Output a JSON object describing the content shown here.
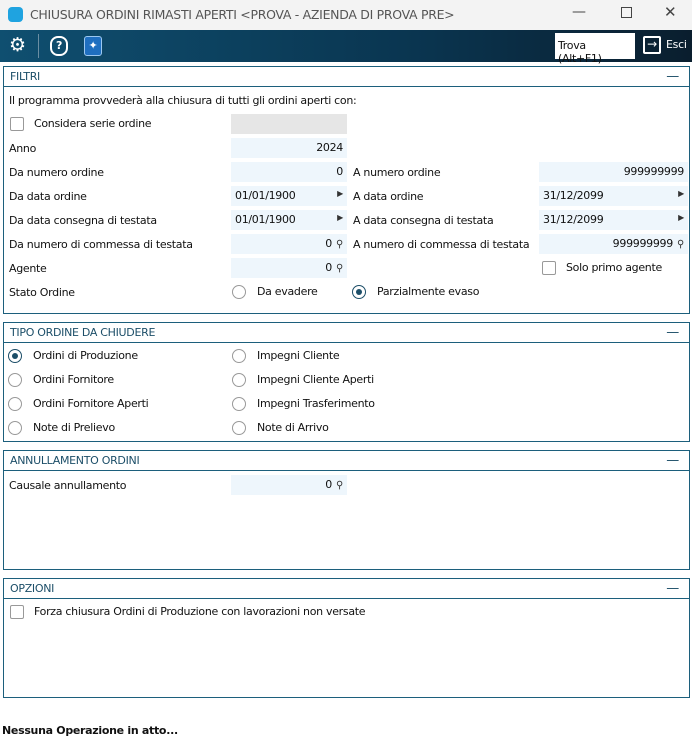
{
  "window": {
    "title": "CHIUSURA ORDINI RIMASTI APERTI <PROVA - AZIENDA DI PROVA PRE>"
  },
  "toolbar": {
    "find_label": "Trova (Alt+F1)",
    "exit_label": "Esci"
  },
  "filtri": {
    "title": "FILTRI",
    "intro": "Il programma provvederà alla chiusura di tutti gli ordini aperti con:",
    "considera_serie": "Considera serie ordine",
    "anno_label": "Anno",
    "anno": "2024",
    "da_num_label": "Da numero ordine",
    "da_num": "0",
    "a_num_label": "A numero ordine",
    "a_num": "999999999",
    "da_data_label": "Da data ordine",
    "da_data": "01/01/1900",
    "a_data_label": "A data ordine",
    "a_data": "31/12/2099",
    "da_cons_label": "Da data consegna di testata",
    "da_cons": "01/01/1900",
    "a_cons_label": "A data consegna di testata",
    "a_cons": "31/12/2099",
    "da_comm_label": "Da numero di commessa di testata",
    "da_comm": "0",
    "a_comm_label": "A numero di commessa di testata",
    "a_comm": "999999999",
    "agente_label": "Agente",
    "agente": "0",
    "solo_primo": "Solo primo agente",
    "stato_label": "Stato Ordine",
    "stato_opt1": "Da evadere",
    "stato_opt2": "Parzialmente evaso"
  },
  "tipo": {
    "title": "TIPO ORDINE DA CHIUDERE",
    "options": [
      "Ordini di Produzione",
      "Ordini Fornitore",
      "Ordini Fornitore Aperti",
      "Note di Prelievo",
      "Impegni Cliente",
      "Impegni Cliente Aperti",
      "Impegni Trasferimento",
      "Note di Arrivo"
    ],
    "selected": "Ordini di Produzione"
  },
  "annullamento": {
    "title": "ANNULLAMENTO ORDINI",
    "causale_label": "Causale annullamento",
    "causale": "0"
  },
  "opzioni": {
    "title": "OPZIONI",
    "forza": "Forza chiusura Ordini di Produzione con lavorazioni non versate"
  },
  "status": "Nessuna Operazione in atto..."
}
